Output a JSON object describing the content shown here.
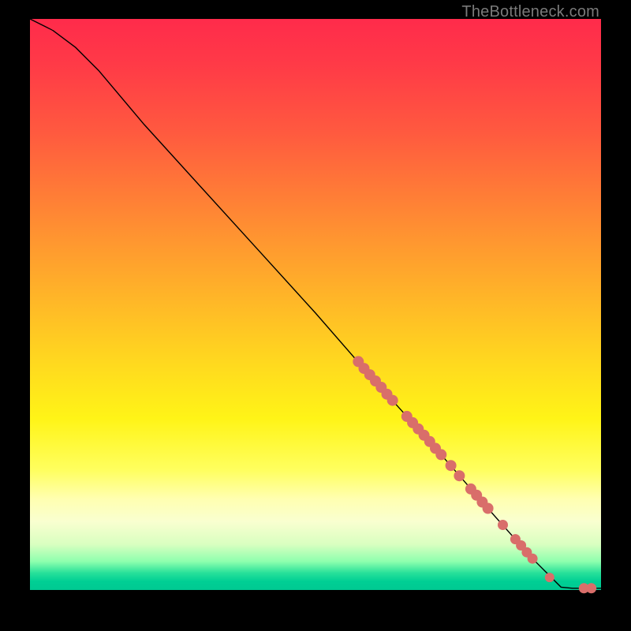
{
  "watermark": "TheBottleneck.com",
  "colors": {
    "background": "#000000",
    "curve": "#000000",
    "marker": "#d96e6a",
    "gradient_top": "#ff2b4b",
    "gradient_bottom": "#00c992"
  },
  "chart_data": {
    "type": "line",
    "title": "",
    "xlabel": "",
    "ylabel": "",
    "xlim": [
      0,
      100
    ],
    "ylim": [
      0,
      100
    ],
    "curve": [
      {
        "x": 0,
        "y": 100
      },
      {
        "x": 4,
        "y": 98
      },
      {
        "x": 8,
        "y": 95
      },
      {
        "x": 12,
        "y": 91
      },
      {
        "x": 20,
        "y": 81.5
      },
      {
        "x": 30,
        "y": 70.5
      },
      {
        "x": 40,
        "y": 59.5
      },
      {
        "x": 50,
        "y": 48.5
      },
      {
        "x": 60,
        "y": 37
      },
      {
        "x": 70,
        "y": 26
      },
      {
        "x": 80,
        "y": 14.5
      },
      {
        "x": 88,
        "y": 5.5
      },
      {
        "x": 93,
        "y": 0.5
      },
      {
        "x": 95,
        "y": 0.3
      },
      {
        "x": 100,
        "y": 0.3
      }
    ],
    "markers": [
      {
        "x": 57.5,
        "y": 40.0,
        "r": 7
      },
      {
        "x": 58.5,
        "y": 38.8,
        "r": 7
      },
      {
        "x": 59.5,
        "y": 37.7,
        "r": 7
      },
      {
        "x": 60.5,
        "y": 36.6,
        "r": 7
      },
      {
        "x": 61.5,
        "y": 35.5,
        "r": 7
      },
      {
        "x": 62.5,
        "y": 34.3,
        "r": 7
      },
      {
        "x": 63.5,
        "y": 33.2,
        "r": 7
      },
      {
        "x": 66.0,
        "y": 30.4,
        "r": 7
      },
      {
        "x": 67.0,
        "y": 29.3,
        "r": 7
      },
      {
        "x": 68.0,
        "y": 28.2,
        "r": 7
      },
      {
        "x": 69.0,
        "y": 27.1,
        "r": 7
      },
      {
        "x": 70.0,
        "y": 26.0,
        "r": 7
      },
      {
        "x": 71.0,
        "y": 24.8,
        "r": 7
      },
      {
        "x": 72.0,
        "y": 23.7,
        "r": 7
      },
      {
        "x": 73.7,
        "y": 21.8,
        "r": 7
      },
      {
        "x": 75.2,
        "y": 20.0,
        "r": 7
      },
      {
        "x": 77.2,
        "y": 17.7,
        "r": 7
      },
      {
        "x": 78.2,
        "y": 16.6,
        "r": 7
      },
      {
        "x": 79.2,
        "y": 15.4,
        "r": 7
      },
      {
        "x": 80.2,
        "y": 14.3,
        "r": 7
      },
      {
        "x": 82.8,
        "y": 11.4,
        "r": 6.5
      },
      {
        "x": 85.0,
        "y": 8.9,
        "r": 6.5
      },
      {
        "x": 86.0,
        "y": 7.8,
        "r": 6.5
      },
      {
        "x": 87.0,
        "y": 6.6,
        "r": 6.5
      },
      {
        "x": 88.0,
        "y": 5.5,
        "r": 6.5
      },
      {
        "x": 91.0,
        "y": 2.2,
        "r": 6
      },
      {
        "x": 97.0,
        "y": 0.3,
        "r": 6.5
      },
      {
        "x": 98.3,
        "y": 0.3,
        "r": 6.5
      }
    ]
  }
}
